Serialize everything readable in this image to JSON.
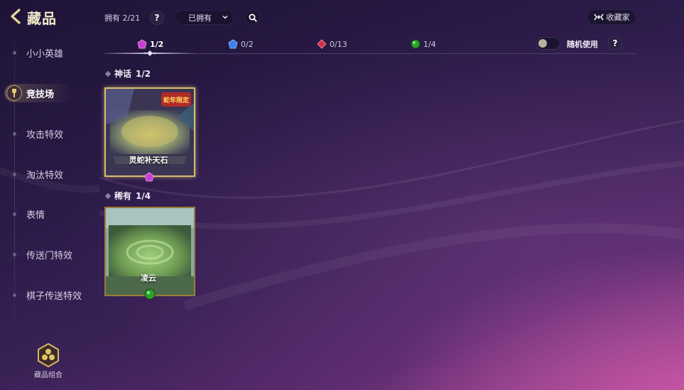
{
  "header": {
    "title": "藏品",
    "owned_count": "拥有 2/21",
    "help_label": "?",
    "filter_value": "已拥有",
    "collector_label": "收藏家"
  },
  "sidebar": {
    "items": [
      {
        "label": "小小英雄",
        "active": false
      },
      {
        "label": "竞技场",
        "active": true
      },
      {
        "label": "攻击特效",
        "active": false
      },
      {
        "label": "淘汰特效",
        "active": false
      },
      {
        "label": "表情",
        "active": false
      },
      {
        "label": "传送门特效",
        "active": false
      },
      {
        "label": "棋子传送特效",
        "active": false
      }
    ],
    "combo_label": "藏品组合"
  },
  "tabs": [
    {
      "count": "1/2",
      "gem": "purple-gem-icon",
      "color": "#c83fd0",
      "active": true
    },
    {
      "count": "0/2",
      "gem": "blue-gem-icon",
      "color": "#3b7ff0",
      "active": false
    },
    {
      "count": "0/13",
      "gem": "red-gem-icon",
      "color": "#d23048",
      "active": false
    },
    {
      "count": "1/4",
      "gem": "green-gem-icon",
      "color": "#2fa02c",
      "active": false
    }
  ],
  "random": {
    "label": "随机使用",
    "enabled": false
  },
  "sections": {
    "mythic": {
      "title": "神话",
      "count": "1/2",
      "card_name": "灵蛇补天石",
      "card_badge": "蛇年限定",
      "gem_color": "#c83fd0"
    },
    "rare": {
      "title": "稀有",
      "count": "1/4",
      "card_name": "凌云",
      "gem_color": "#2fa02c"
    }
  },
  "colors": {
    "accent_gold": "#d9bd6a",
    "title_gold": "#f0e9c8"
  }
}
